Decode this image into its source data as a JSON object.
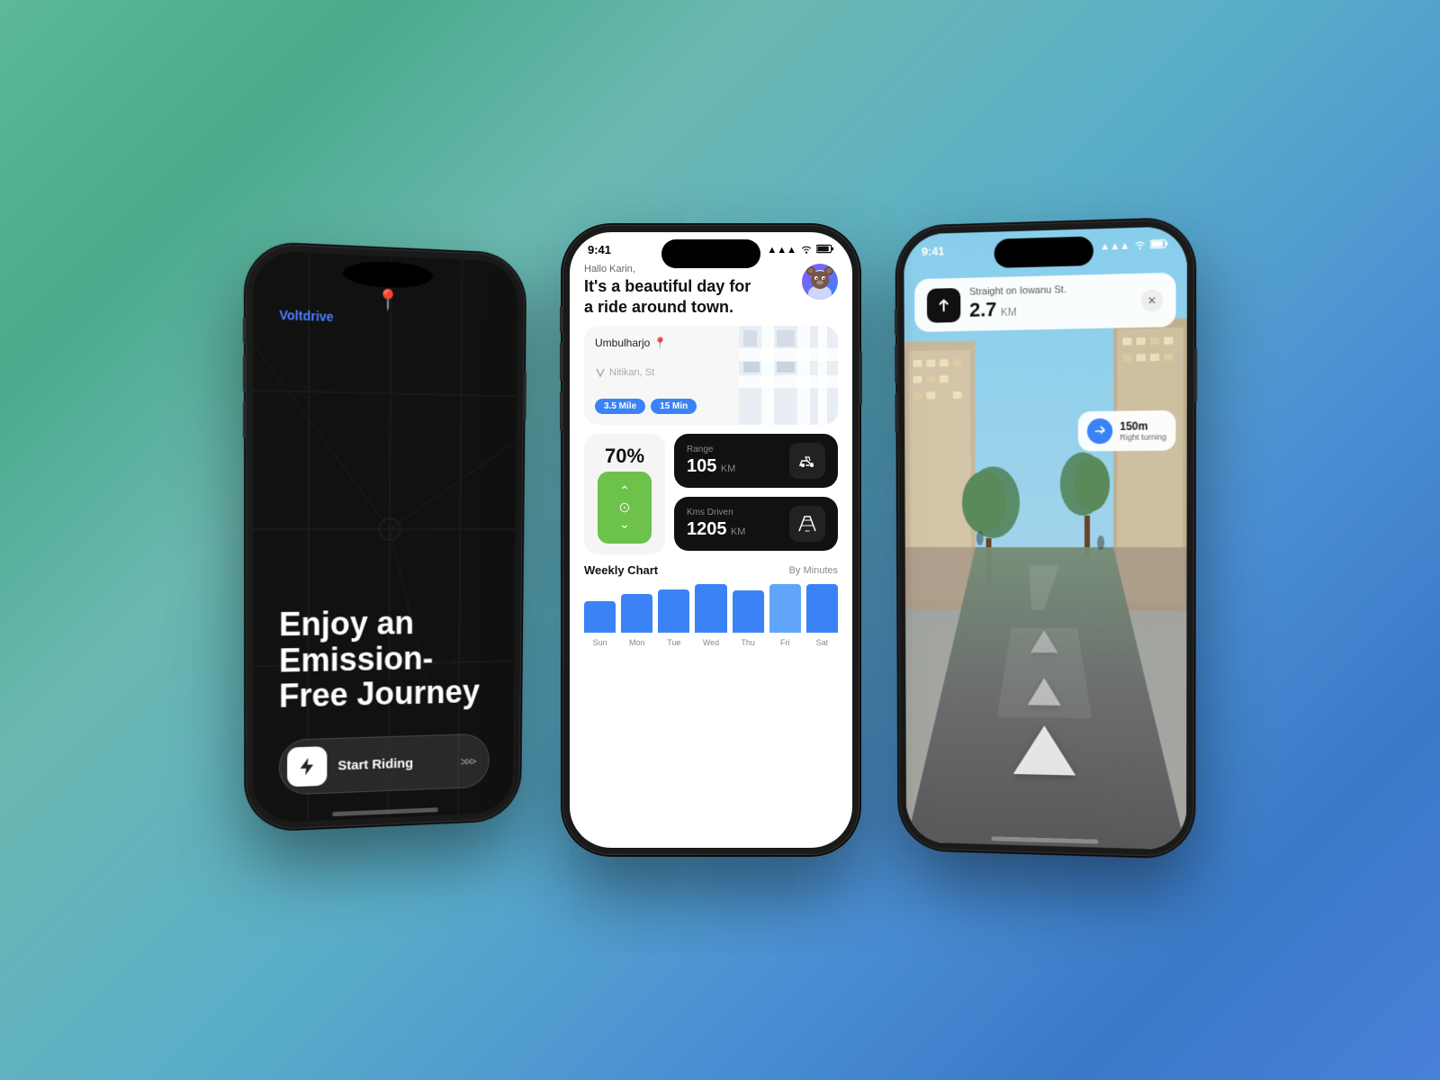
{
  "app": {
    "name": "Voltdrive",
    "tagline": "Enjoy an Emission-Free Journey",
    "brand_color": "#4a7fff"
  },
  "phone_left": {
    "brand": "Voltdrive",
    "tagline": "Enjoy an Emission-Free Journey",
    "cta_label": "Start Riding",
    "cta_arrows": ">>>"
  },
  "phone_center": {
    "status_time": "9:41",
    "status_signal": "●●●",
    "status_wifi": "wifi",
    "status_battery": "battery",
    "greeting_sub": "Hallo Karin,",
    "greeting_main": "It's a beautiful day for a ride around town.",
    "route": {
      "from": "Umbulharjo",
      "to": "Nitikan, St",
      "distance_tag": "3.5 Mile",
      "time_tag": "15 Min"
    },
    "battery_pct": "70%",
    "range_label": "Range",
    "range_value": "105",
    "range_unit": "KM",
    "kms_label": "Kms Driven",
    "kms_value": "1205",
    "kms_unit": "KM",
    "chart": {
      "title": "Weekly Chart",
      "subtitle": "By Minutes",
      "days": [
        "Sun",
        "Mon",
        "Tue",
        "Wed",
        "Thu",
        "Fri",
        "Sat"
      ],
      "heights": [
        45,
        55,
        62,
        75,
        60,
        85,
        90
      ]
    }
  },
  "phone_right": {
    "status_time": "9:41",
    "nav_street": "Straight on Iowanu St.",
    "nav_distance": "2.7",
    "nav_unit": "KM",
    "turn_distance": "150m",
    "turn_direction": "Right turning"
  }
}
